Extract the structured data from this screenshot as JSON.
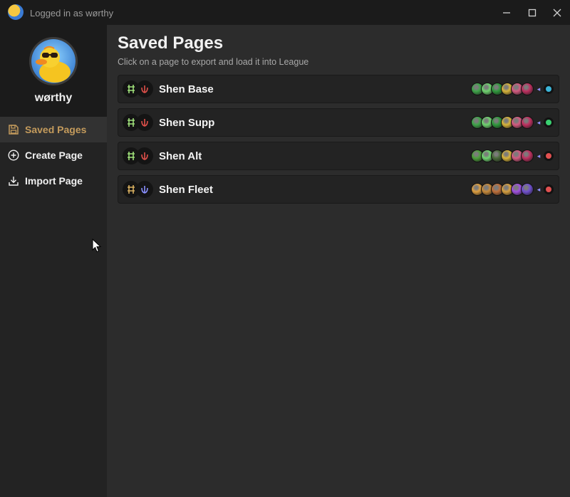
{
  "window": {
    "title": "Logged in as wørthy"
  },
  "profile": {
    "username": "wørthy"
  },
  "sidebar": {
    "items": [
      {
        "label": "Saved Pages",
        "icon": "save-icon",
        "active": true
      },
      {
        "label": "Create Page",
        "icon": "plus-circle-icon",
        "active": false
      },
      {
        "label": "Import Page",
        "icon": "download-icon",
        "active": false
      }
    ]
  },
  "main": {
    "title": "Saved Pages",
    "subtitle": "Click on a page to export and load it into League",
    "pages": [
      {
        "name": "Shen Base",
        "primary_color": "#9fe07a",
        "secondary_color": "#e0504a",
        "shard_color": "#3bb5d8",
        "rune_colors": [
          "#3fa64a",
          "#6fd46f",
          "#2f9a3c",
          "#d8b43a",
          "#d45a80",
          "#c03060"
        ]
      },
      {
        "name": "Shen Supp",
        "primary_color": "#9fe07a",
        "secondary_color": "#e0504a",
        "shard_color": "#3ad070",
        "rune_colors": [
          "#3fa64a",
          "#6fd46f",
          "#2f9a3c",
          "#d8b43a",
          "#d45a80",
          "#c03060"
        ]
      },
      {
        "name": "Shen Alt",
        "primary_color": "#9fe07a",
        "secondary_color": "#e0504a",
        "shard_color": "#e05050",
        "rune_colors": [
          "#4ca03a",
          "#6fd46f",
          "#4a6a3a",
          "#d8b43a",
          "#d45a80",
          "#c03060"
        ]
      },
      {
        "name": "Shen Fleet",
        "primary_color": "#d8b060",
        "secondary_color": "#8a90ff",
        "shard_color": "#e05050",
        "rune_colors": [
          "#e0a040",
          "#c88a3a",
          "#c0703a",
          "#d8a040",
          "#a050e0",
          "#7050d0"
        ]
      }
    ]
  }
}
